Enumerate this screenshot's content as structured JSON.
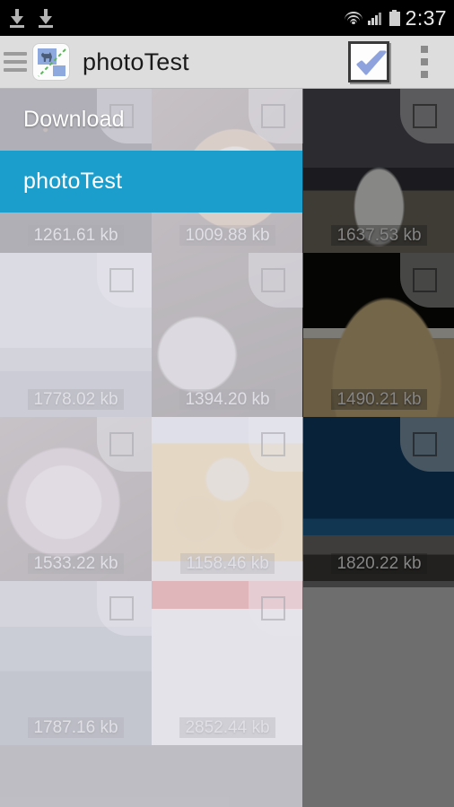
{
  "status_bar": {
    "left_icons": [
      "download-icon",
      "download-icon"
    ],
    "right_icons": [
      "wifi-icon",
      "signal-icon",
      "battery-icon"
    ],
    "clock": "2:37"
  },
  "action_bar": {
    "menu_icon": "hamburger-icon",
    "app_icon": "gallery-app-icon",
    "title": "photoTest",
    "select_all_label": "check-icon",
    "overflow_label": "more-options-icon"
  },
  "drawer": {
    "items": [
      {
        "label": "Download",
        "selected": false
      },
      {
        "label": "photoTest",
        "selected": true
      }
    ],
    "accent_color": "#1c9ecd",
    "background_color": "rgba(222,221,230,0.72)"
  },
  "grid": {
    "columns": 3,
    "checkbox_state": "unchecked",
    "cells": [
      {
        "size": "1261.61 kb",
        "photo": "ph-airport",
        "col": 0,
        "row": 0
      },
      {
        "size": "1009.88 kb",
        "photo": "ph-plate",
        "col": 1,
        "row": 0
      },
      {
        "size": "1637.53 kb",
        "photo": "ph-plane",
        "col": 2,
        "row": 0
      },
      {
        "size": "1778.02 kb",
        "photo": "ph-fuku",
        "col": 0,
        "row": 1
      },
      {
        "size": "1394.20 kb",
        "photo": "ph-cup",
        "col": 1,
        "row": 1
      },
      {
        "size": "1490.21 kb",
        "photo": "ph-ramen",
        "col": 2,
        "row": 1
      },
      {
        "size": "1533.22 kb",
        "photo": "ph-drink",
        "col": 0,
        "row": 2
      },
      {
        "size": "1158.46 kb",
        "photo": "ph-food",
        "col": 1,
        "row": 2
      },
      {
        "size": "1820.22 kb",
        "photo": "ph-city",
        "col": 2,
        "row": 2
      },
      {
        "size": "1787.16 kb",
        "photo": "ph-aerial",
        "col": 0,
        "row": 3
      },
      {
        "size": "2852.44 kb",
        "photo": "ph-map",
        "col": 1,
        "row": 3
      }
    ]
  },
  "colors": {
    "status_bar_bg": "#000000",
    "action_bar_bg": "#dddddd",
    "scrim": "rgba(0,0,0,0.42)",
    "page_bg": "#6e6e6e"
  }
}
